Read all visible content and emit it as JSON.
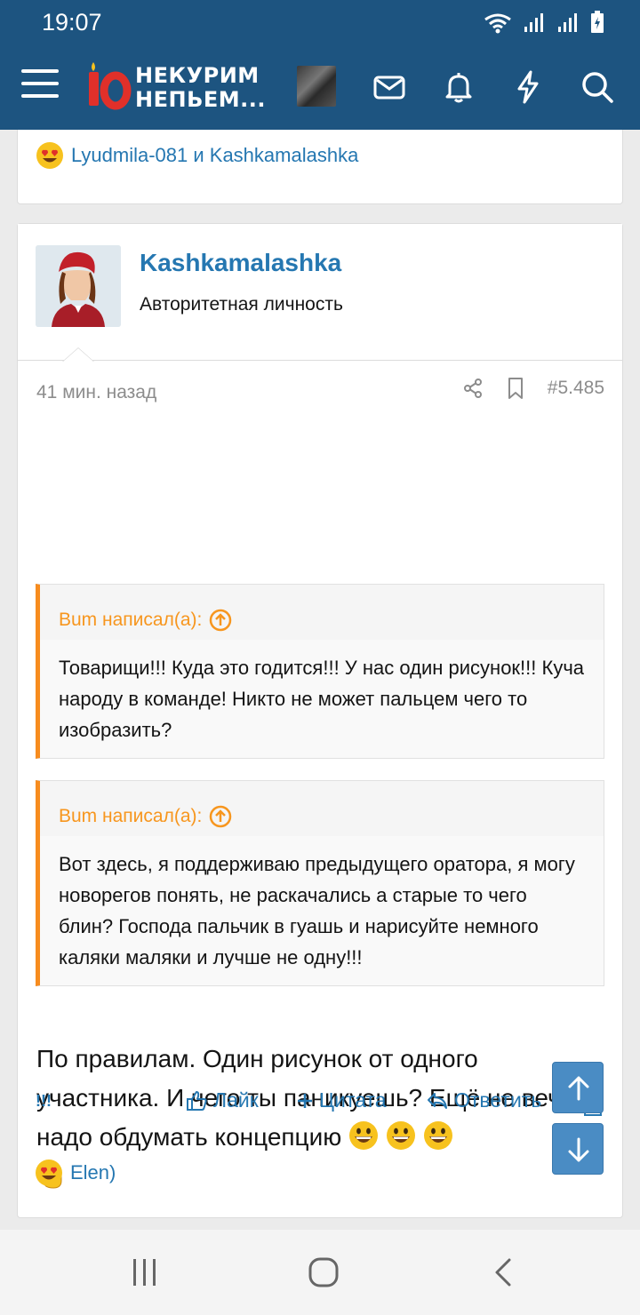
{
  "status": {
    "time": "19:07"
  },
  "header": {
    "logo_line1": "НЕКУРИМ",
    "logo_line2": "НЕПЬЕМ..."
  },
  "prev_post": {
    "reactions_text": "Lyudmila-081 и Kashkamalashka"
  },
  "post": {
    "username": "Kashkamalashka",
    "user_title": "Авторитетная личность",
    "time": "41 мин. назад",
    "number": "#5.485",
    "quotes": [
      {
        "author": "Bum написал(а):",
        "text": "Товарищи!!! Куда это годится!!! У нас один рисунок!!! Куча народу в команде! Никто не может пальцем чего то изобразить?"
      },
      {
        "author": "Bum написал(а):",
        "text": "Вот здесь, я поддерживаю предыдущего оратора, я могу новорегов понять, не раскачались а старые то чего блин? Господа пальчик в гуашь и нарисуйте немного каляки маляки и лучше не одну!!!"
      }
    ],
    "message": "По правилам. Один рисунок от одного участника. И чего ты паникуешь? Ещё не вечер)) надо обдумать концепцию",
    "report_label": "!!!",
    "like_label": "Лайк",
    "quote_label": "Цитата",
    "reply_label": "Ответить",
    "reactions_text": "Elen)"
  },
  "colors": {
    "header_bg": "#1d5480",
    "link": "#2577b1",
    "quote_accent": "#f78c1e",
    "fab_bg": "#4a8cc4"
  }
}
